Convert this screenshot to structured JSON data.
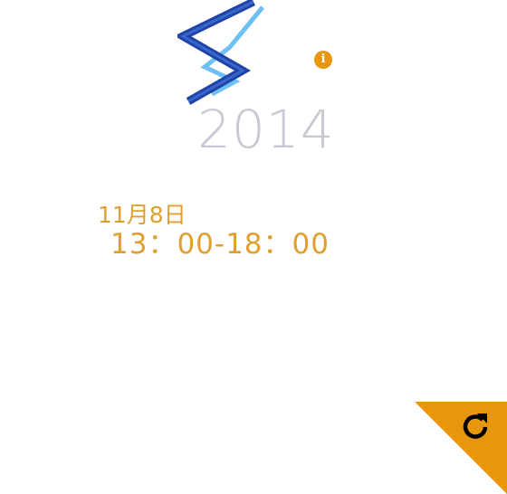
{
  "header": {
    "logo_icon": "zigzag-ribbon-logo",
    "year": "2014",
    "info_icon": "info-icon",
    "info_glyph": "i"
  },
  "event": {
    "date": "11月8日",
    "time": "13：00-18：00"
  },
  "footer": {
    "reload_icon": "reload-icon"
  },
  "colors": {
    "accent": "#e8960e",
    "text_orange": "#e0a030",
    "year_gray": "#c8c8d2",
    "logo_dark_blue": "#1e44a8",
    "logo_light_blue": "#6ec0f4"
  }
}
